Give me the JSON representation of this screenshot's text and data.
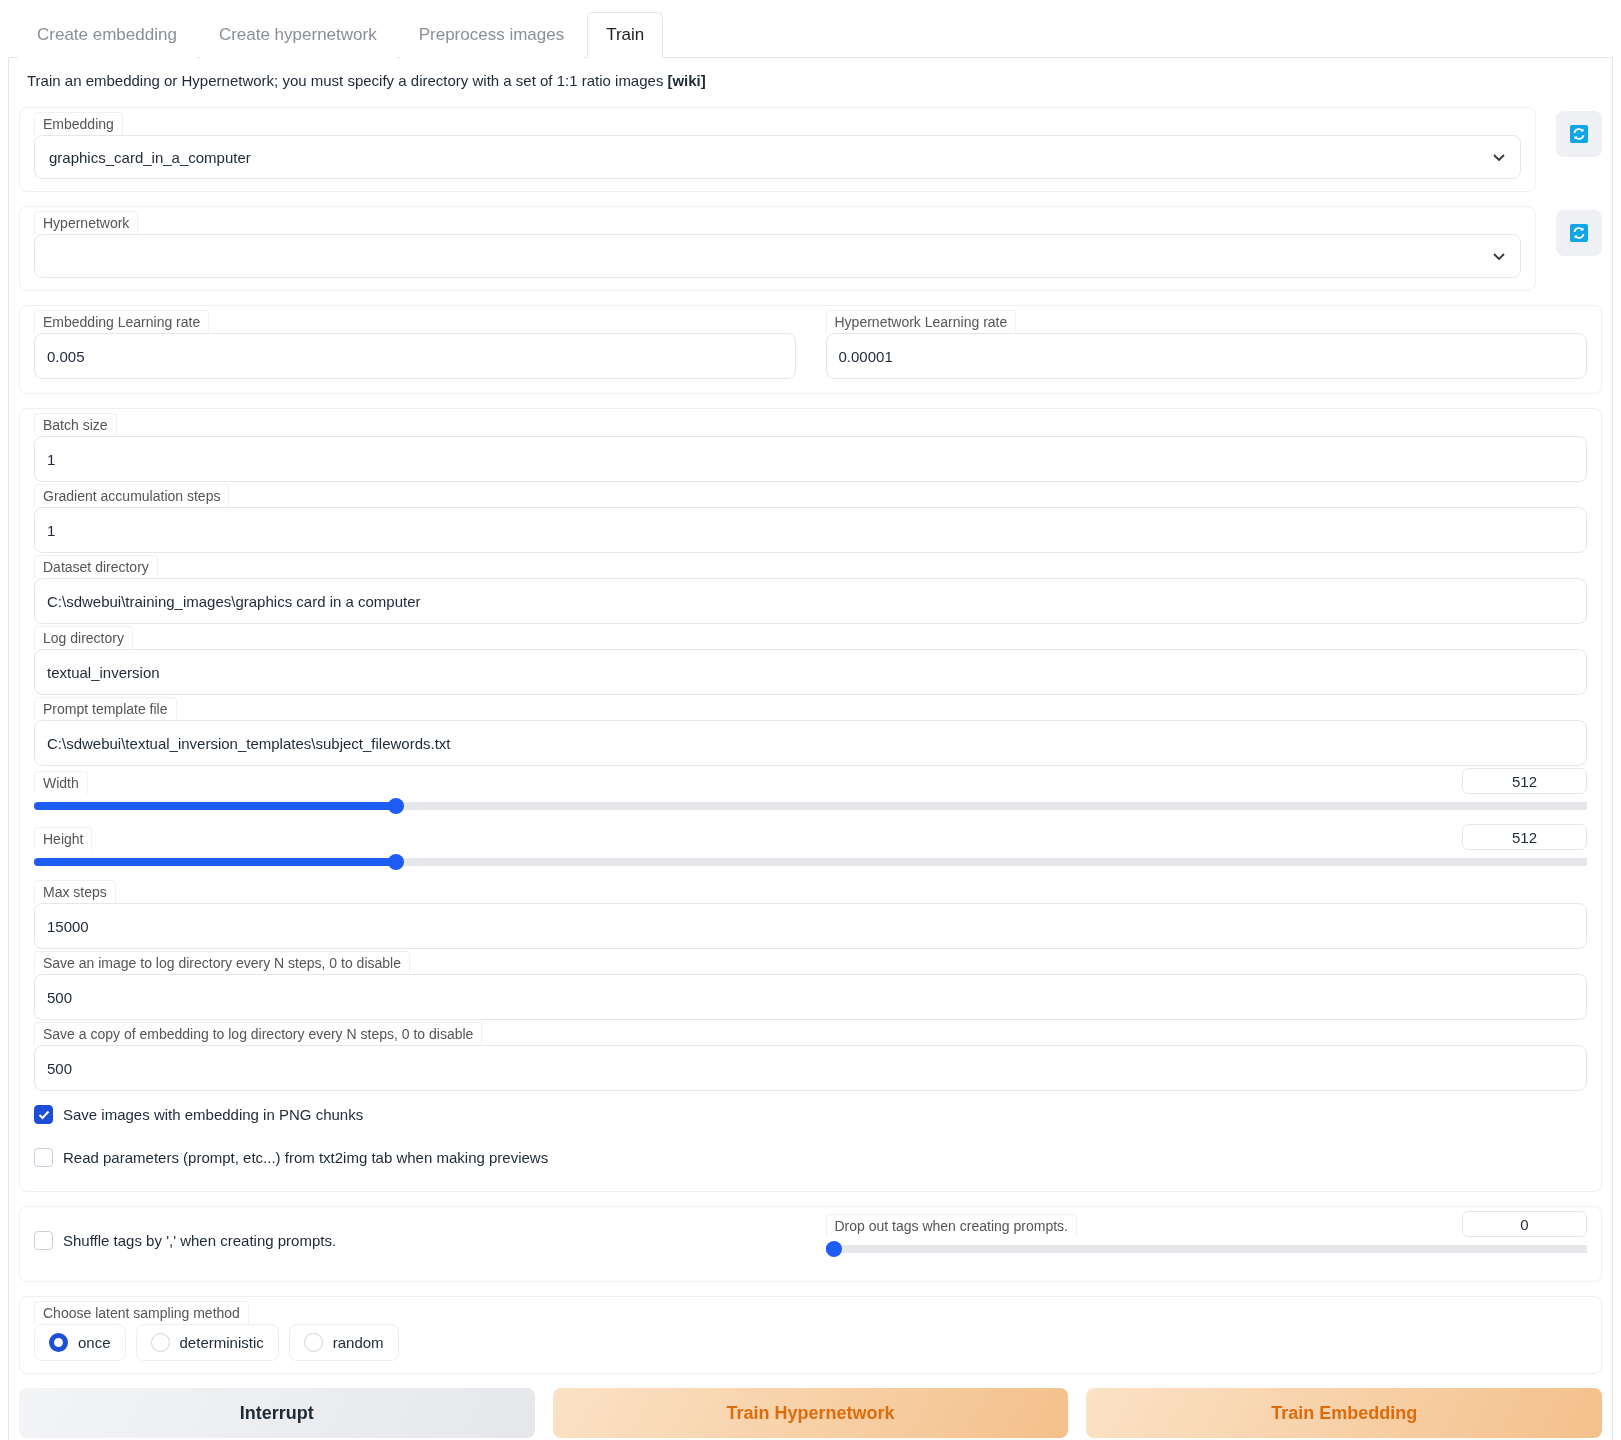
{
  "tabs": [
    {
      "label": "Create embedding",
      "selected": false
    },
    {
      "label": "Create hypernetwork",
      "selected": false
    },
    {
      "label": "Preprocess images",
      "selected": false
    },
    {
      "label": "Train",
      "selected": true
    }
  ],
  "description": {
    "text": "Train an embedding or Hypernetwork; you must specify a directory with a set of 1:1 ratio images",
    "link": "[wiki]"
  },
  "selects": [
    {
      "label": "Embedding",
      "value": "graphics_card_in_a_computer"
    },
    {
      "label": "Hypernetwork"
    }
  ],
  "learning_rates": [
    {
      "label": "Embedding Learning rate",
      "value": "0.005"
    },
    {
      "label": "Hypernetwork Learning rate",
      "value": "0.00001"
    }
  ],
  "settings": [
    {
      "kind": "text",
      "label": "Batch size",
      "value": "1"
    },
    {
      "kind": "text",
      "label": "Gradient accumulation steps",
      "value": "1"
    },
    {
      "kind": "text",
      "label": "Dataset directory",
      "value": "C:\\sdwebui\\training_images\\graphics card in a computer"
    },
    {
      "kind": "text",
      "label": "Log directory",
      "value": "textual_inversion"
    },
    {
      "kind": "text",
      "label": "Prompt template file",
      "value": "C:\\sdwebui\\textual_inversion_templates\\subject_filewords.txt"
    },
    {
      "kind": "slider",
      "label": "Width",
      "value": "512",
      "level": 0.23
    },
    {
      "kind": "slider",
      "label": "Height",
      "value": "512",
      "level": 0.23
    },
    {
      "kind": "text",
      "label": "Max steps",
      "value": "15000"
    },
    {
      "kind": "text",
      "label": "Save an image to log directory every N steps, 0 to disable",
      "value": "500"
    },
    {
      "kind": "text",
      "label": "Save a copy of embedding to log directory every N steps, 0 to disable",
      "value": "500"
    },
    {
      "kind": "checkbox",
      "label": "Save images with embedding in PNG chunks",
      "checked": true
    },
    {
      "kind": "checkbox",
      "label": "Read parameters (prompt, etc...) from txt2img tab when making previews",
      "checked": false
    }
  ],
  "shuffle": {
    "label": "Shuffle tags by ',' when creating prompts.",
    "checked": false
  },
  "dropout": {
    "label": "Drop out tags when creating prompts.",
    "value": "0",
    "level": 0
  },
  "sampling": {
    "label": "Choose latent sampling method",
    "options": [
      {
        "label": "once",
        "selected": true
      },
      {
        "label": "deterministic",
        "selected": false
      },
      {
        "label": "random",
        "selected": false
      }
    ]
  },
  "buttons": [
    {
      "label": "Interrupt",
      "kind": "secondary"
    },
    {
      "label": "Train Hypernetwork",
      "kind": "primary"
    },
    {
      "label": "Train Embedding",
      "kind": "primary"
    }
  ]
}
